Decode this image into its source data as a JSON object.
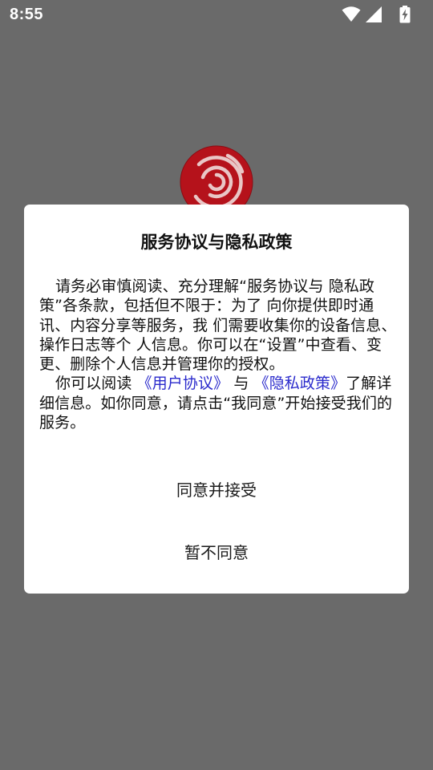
{
  "status_bar": {
    "time": "8:55",
    "icons": [
      "wifi-icon",
      "cellular-signal-icon",
      "battery-charging-icon"
    ]
  },
  "background": {
    "logo_icon": "swirl-logo-icon",
    "logo_color": "#b5121b"
  },
  "dialog": {
    "title": "服务协议与隐私政策",
    "paragraph1": "请务必审慎阅读、充分理解“服务协议与 隐私政策”各条款，包括但不限于：为了 向你提供即时通讯、内容分享等服务，我 们需要收集你的设备信息、操作日志等个 人信息。你可以在“设置”中查看、变更、删除个人信息并管理你的授权。",
    "p2_prefix": "你可以阅读",
    "user_agreement_link": "《用户协议》",
    "p2_and": "与",
    "privacy_policy_link": "《隐私政策》",
    "p2_suffix": "了解详细信息。如你同意，请点击“我同意”开始接受我们的服务。",
    "accept_button": "同意并接受",
    "decline_button": "暂不同意",
    "link_color": "#2a2acc"
  }
}
